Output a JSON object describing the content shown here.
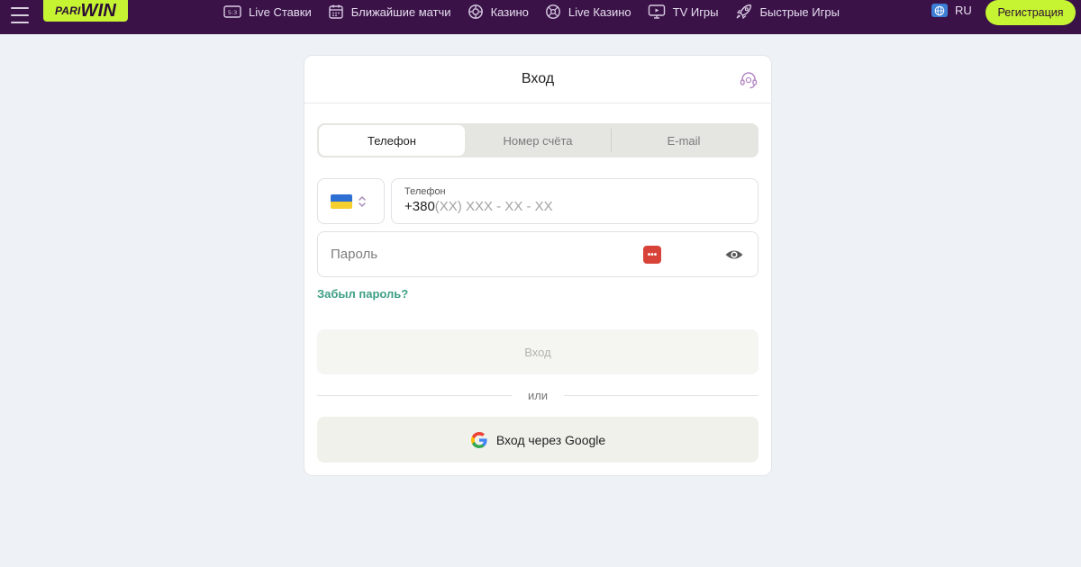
{
  "header": {
    "logo": {
      "pari": "PARI",
      "win": "WIN"
    },
    "nav": [
      {
        "label": "Live Ставки",
        "icon": "live-scoreboard-icon"
      },
      {
        "label": "Ближайшие матчи",
        "icon": "calendar-icon"
      },
      {
        "label": "Казино",
        "icon": "casino-chip-icon"
      },
      {
        "label": "Live Казино",
        "icon": "roulette-icon"
      },
      {
        "label": "TV Игры",
        "icon": "tv-icon"
      },
      {
        "label": "Быстрые Игры",
        "icon": "rocket-icon"
      }
    ],
    "language": "RU",
    "register_label": "Регистрация"
  },
  "login": {
    "title": "Вход",
    "tabs": [
      {
        "label": "Телефон",
        "active": true
      },
      {
        "label": "Номер счёта",
        "active": false
      },
      {
        "label": "E-mail",
        "active": false
      }
    ],
    "phone": {
      "label": "Телефон",
      "prefix": "+380",
      "mask": "(XX) XXX - XX - XX",
      "country_flag": "ukraine-flag-icon"
    },
    "password_placeholder": "Пароль",
    "password_manager_icon": "•••",
    "forgot_label": "Забыл пароль?",
    "submit_label": "Вход",
    "divider_label": "или",
    "google_label": "Вход через Google"
  },
  "colors": {
    "header_bg": "#3a1247",
    "accent_lime": "#c6f432",
    "link_green": "#3e9f85",
    "page_bg": "#eef1f5"
  }
}
